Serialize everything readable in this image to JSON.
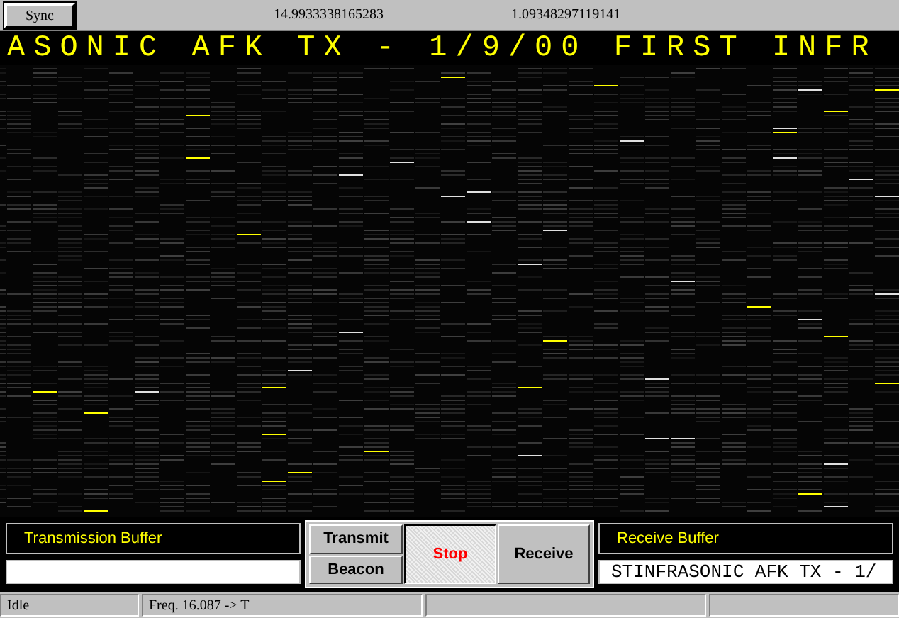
{
  "toolbar": {
    "sync_button": "Sync",
    "readouts": [
      "14.9933338165283",
      "1.09348297119141"
    ]
  },
  "banner": "ASONIC AFK TX - 1/9/00 FIRST INFR",
  "transmit_panel": {
    "label": "Transmission Buffer"
  },
  "controls": [
    {
      "label": "Transmit",
      "kind": "small",
      "pressed": false
    },
    {
      "label": "Beacon",
      "kind": "small",
      "pressed": false
    },
    {
      "label": "Stop",
      "kind": "large",
      "pressed": true
    },
    {
      "label": "Receive",
      "kind": "large",
      "pressed": false
    }
  ],
  "receive_panel": {
    "label": "Receive Buffer",
    "buffer": "STINFRASONIC AFK TX - 1/"
  },
  "status_bar": [
    "Idle",
    "Freq. 16.087 -> T"
  ]
}
